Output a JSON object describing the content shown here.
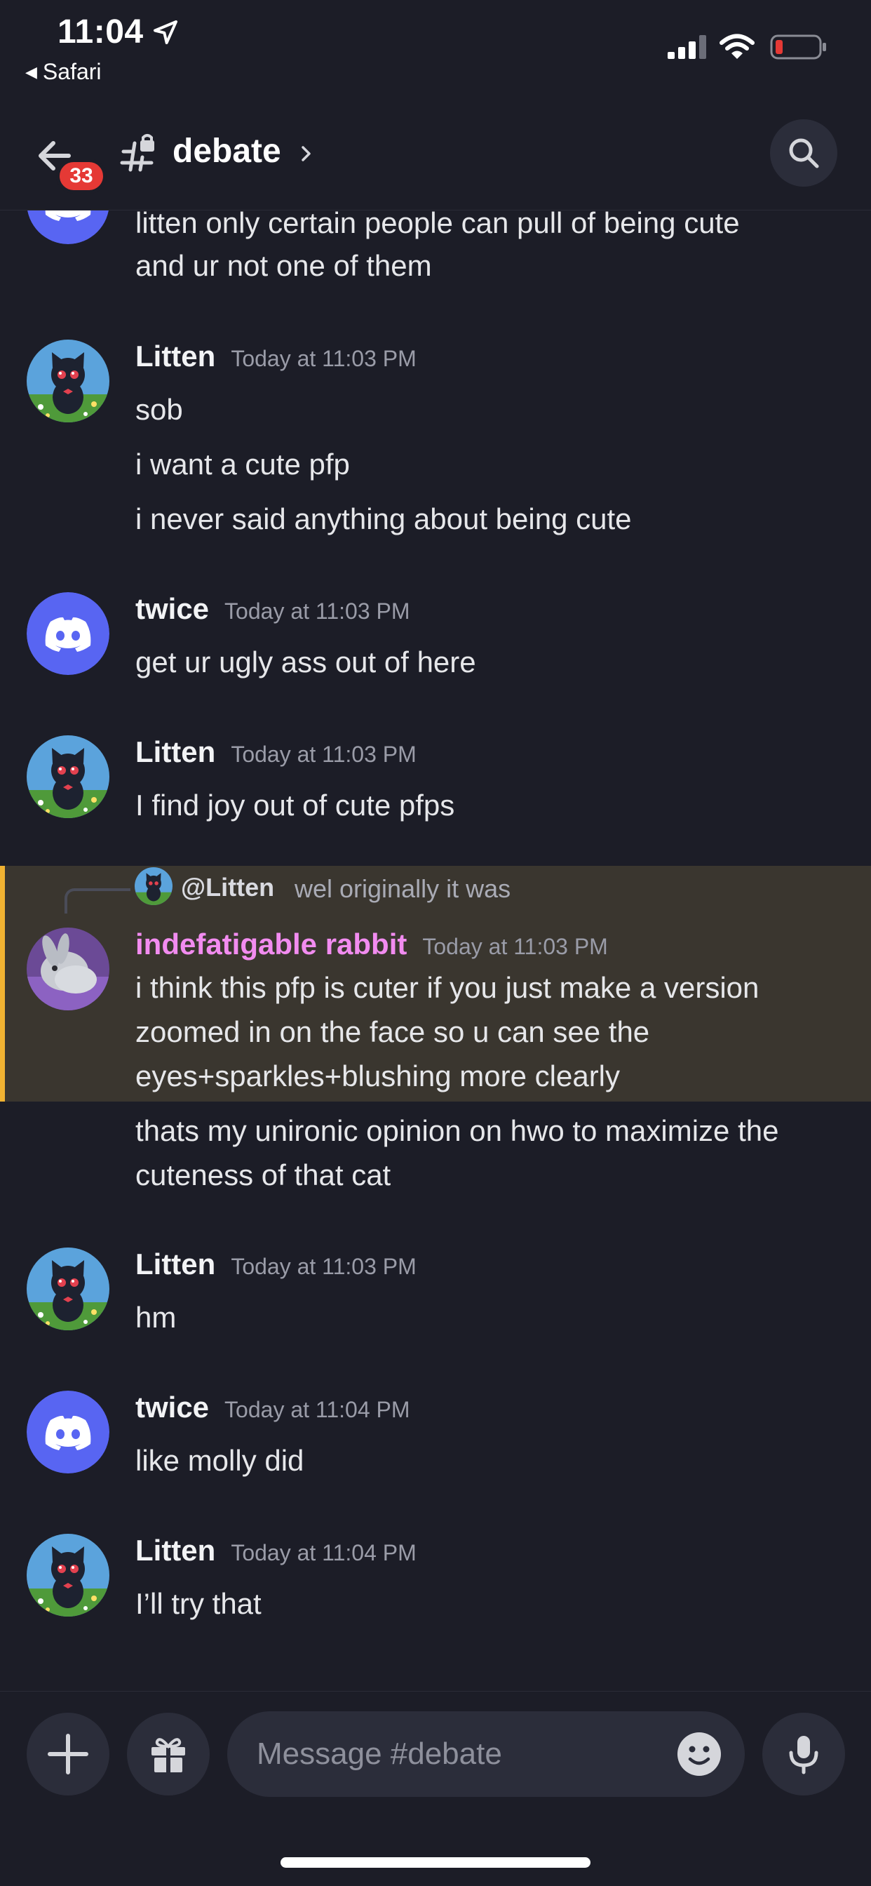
{
  "status_bar": {
    "time": "11:04",
    "back_app": "Safari"
  },
  "header": {
    "unread_count": "33",
    "channel_name": "debate"
  },
  "messages": [
    {
      "id": "m0",
      "author": "",
      "timestamp": "",
      "avatar": "discord-logo",
      "lines": [
        "litten only certain people can pull of being cute",
        "and ur not one of them"
      ]
    },
    {
      "id": "m1",
      "author": "Litten",
      "timestamp": "Today at 11:03 PM",
      "avatar": "cat",
      "lines": [
        "sob",
        "i want a cute pfp",
        "i never said anything about being cute"
      ]
    },
    {
      "id": "m2",
      "author": "twice",
      "timestamp": "Today at 11:03 PM",
      "avatar": "discord-logo",
      "lines": [
        "get ur ugly ass out of here"
      ]
    },
    {
      "id": "m3",
      "author": "Litten",
      "timestamp": "Today at 11:03 PM",
      "avatar": "cat",
      "lines": [
        "I find joy out of cute pfps"
      ]
    },
    {
      "id": "m4",
      "author": "indefatigable rabbit",
      "author_color": "#f28cf0",
      "timestamp": "Today at 11:03 PM",
      "avatar": "rabbit",
      "reply": {
        "name": "@Litten",
        "text": "wel originally it was"
      },
      "lines": [
        "i think this pfp is cuter if you just make a version",
        "zoomed in on the face so u can see the",
        "eyes+sparkles+blushing more clearly"
      ]
    },
    {
      "id": "m4b",
      "author": "",
      "timestamp": "",
      "avatar": "",
      "lines": [
        "thats my unironic opinion on hwo to maximize the",
        "cuteness of that cat"
      ]
    },
    {
      "id": "m5",
      "author": "Litten",
      "timestamp": "Today at 11:03 PM",
      "avatar": "cat",
      "lines": [
        "hm"
      ]
    },
    {
      "id": "m6",
      "author": "twice",
      "timestamp": "Today at 11:04 PM",
      "avatar": "discord-logo",
      "lines": [
        "like molly did"
      ]
    },
    {
      "id": "m7",
      "author": "Litten",
      "timestamp": "Today at 11:04 PM",
      "avatar": "cat",
      "lines": [
        "I’ll try that"
      ]
    }
  ],
  "composer": {
    "placeholder": "Message #debate"
  },
  "colors": {
    "background": "#1c1d27",
    "mention_highlight": "#3a362f",
    "mention_bar": "#f0b232",
    "discord_blurple": "#5865f2",
    "badge_red": "#e53935"
  },
  "icons": [
    "location-arrow-icon",
    "signal-icon",
    "wifi-icon",
    "battery-icon",
    "back-arrow-icon",
    "channel-hash-icon",
    "chevron-right-icon",
    "search-icon",
    "plus-icon",
    "gift-icon",
    "emoji-icon",
    "microphone-icon"
  ]
}
